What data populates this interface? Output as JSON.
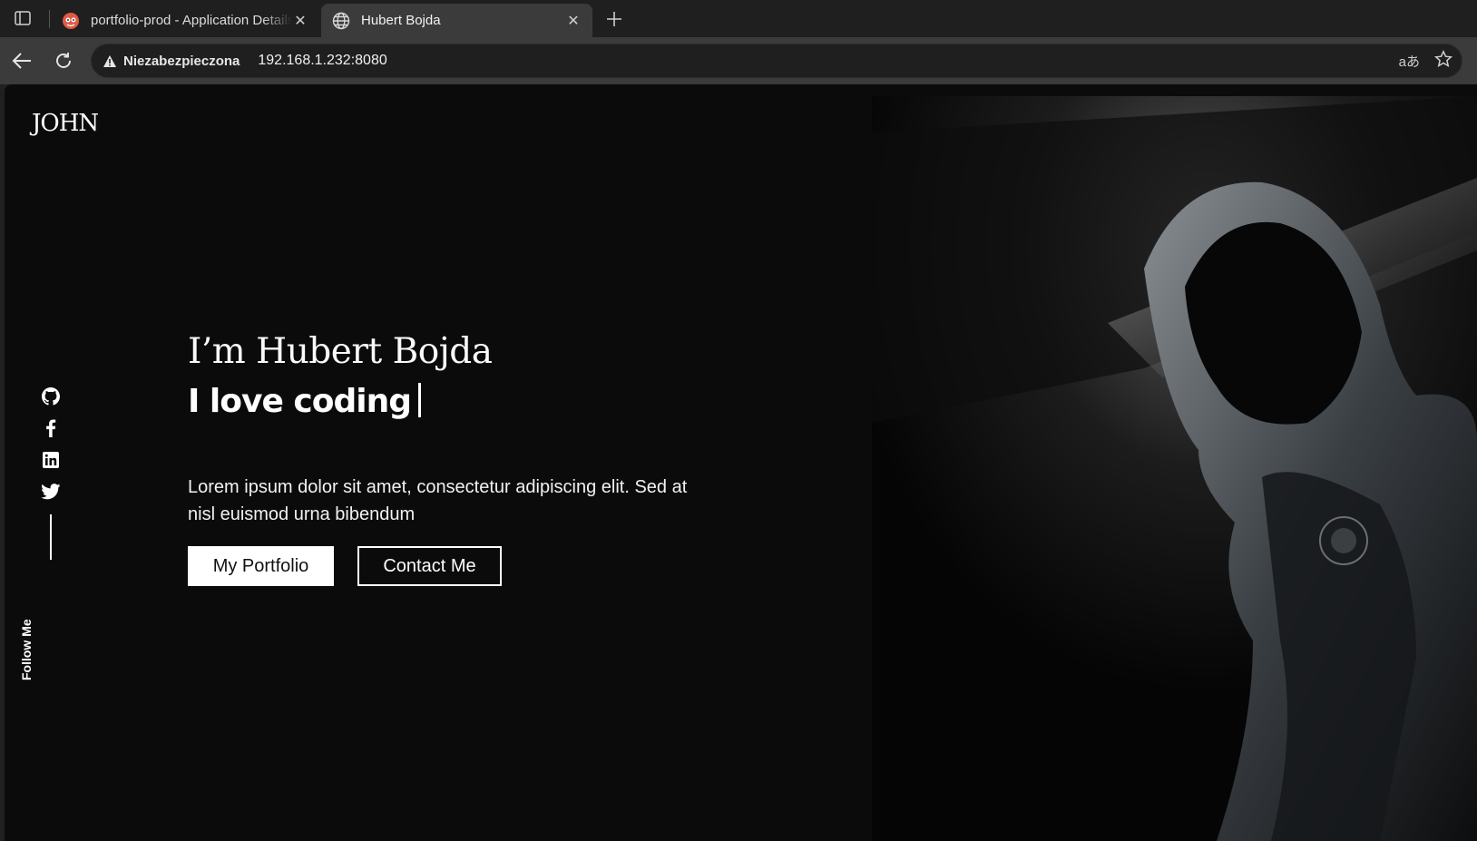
{
  "browser": {
    "tabs": [
      {
        "title": "portfolio-prod - Application Details",
        "active": false,
        "favicon": "app-favicon"
      },
      {
        "title": "Hubert Bojda",
        "active": true,
        "favicon": "globe-icon"
      }
    ],
    "security_label": "Niezabezpieczona",
    "url": "192.168.1.232:8080"
  },
  "page": {
    "brand": "JOHN",
    "hero": {
      "greeting": "I’m Hubert Bojda",
      "tagline": "I love coding",
      "description": "Lorem ipsum dolor sit amet, consectetur adipiscing elit. Sed at nisl euismod urna bibendum",
      "primary_button": "My Portfolio",
      "secondary_button": "Contact Me"
    },
    "social": {
      "icons": [
        "github-icon",
        "facebook-icon",
        "linkedin-icon",
        "twitter-icon"
      ],
      "follow_label": "Follow Me"
    }
  },
  "colors": {
    "page_bg": "#0b0b0c",
    "toolbar_bg": "#3b3b3b",
    "tabstrip_bg": "#1f1f1f",
    "text": "#ffffff"
  }
}
